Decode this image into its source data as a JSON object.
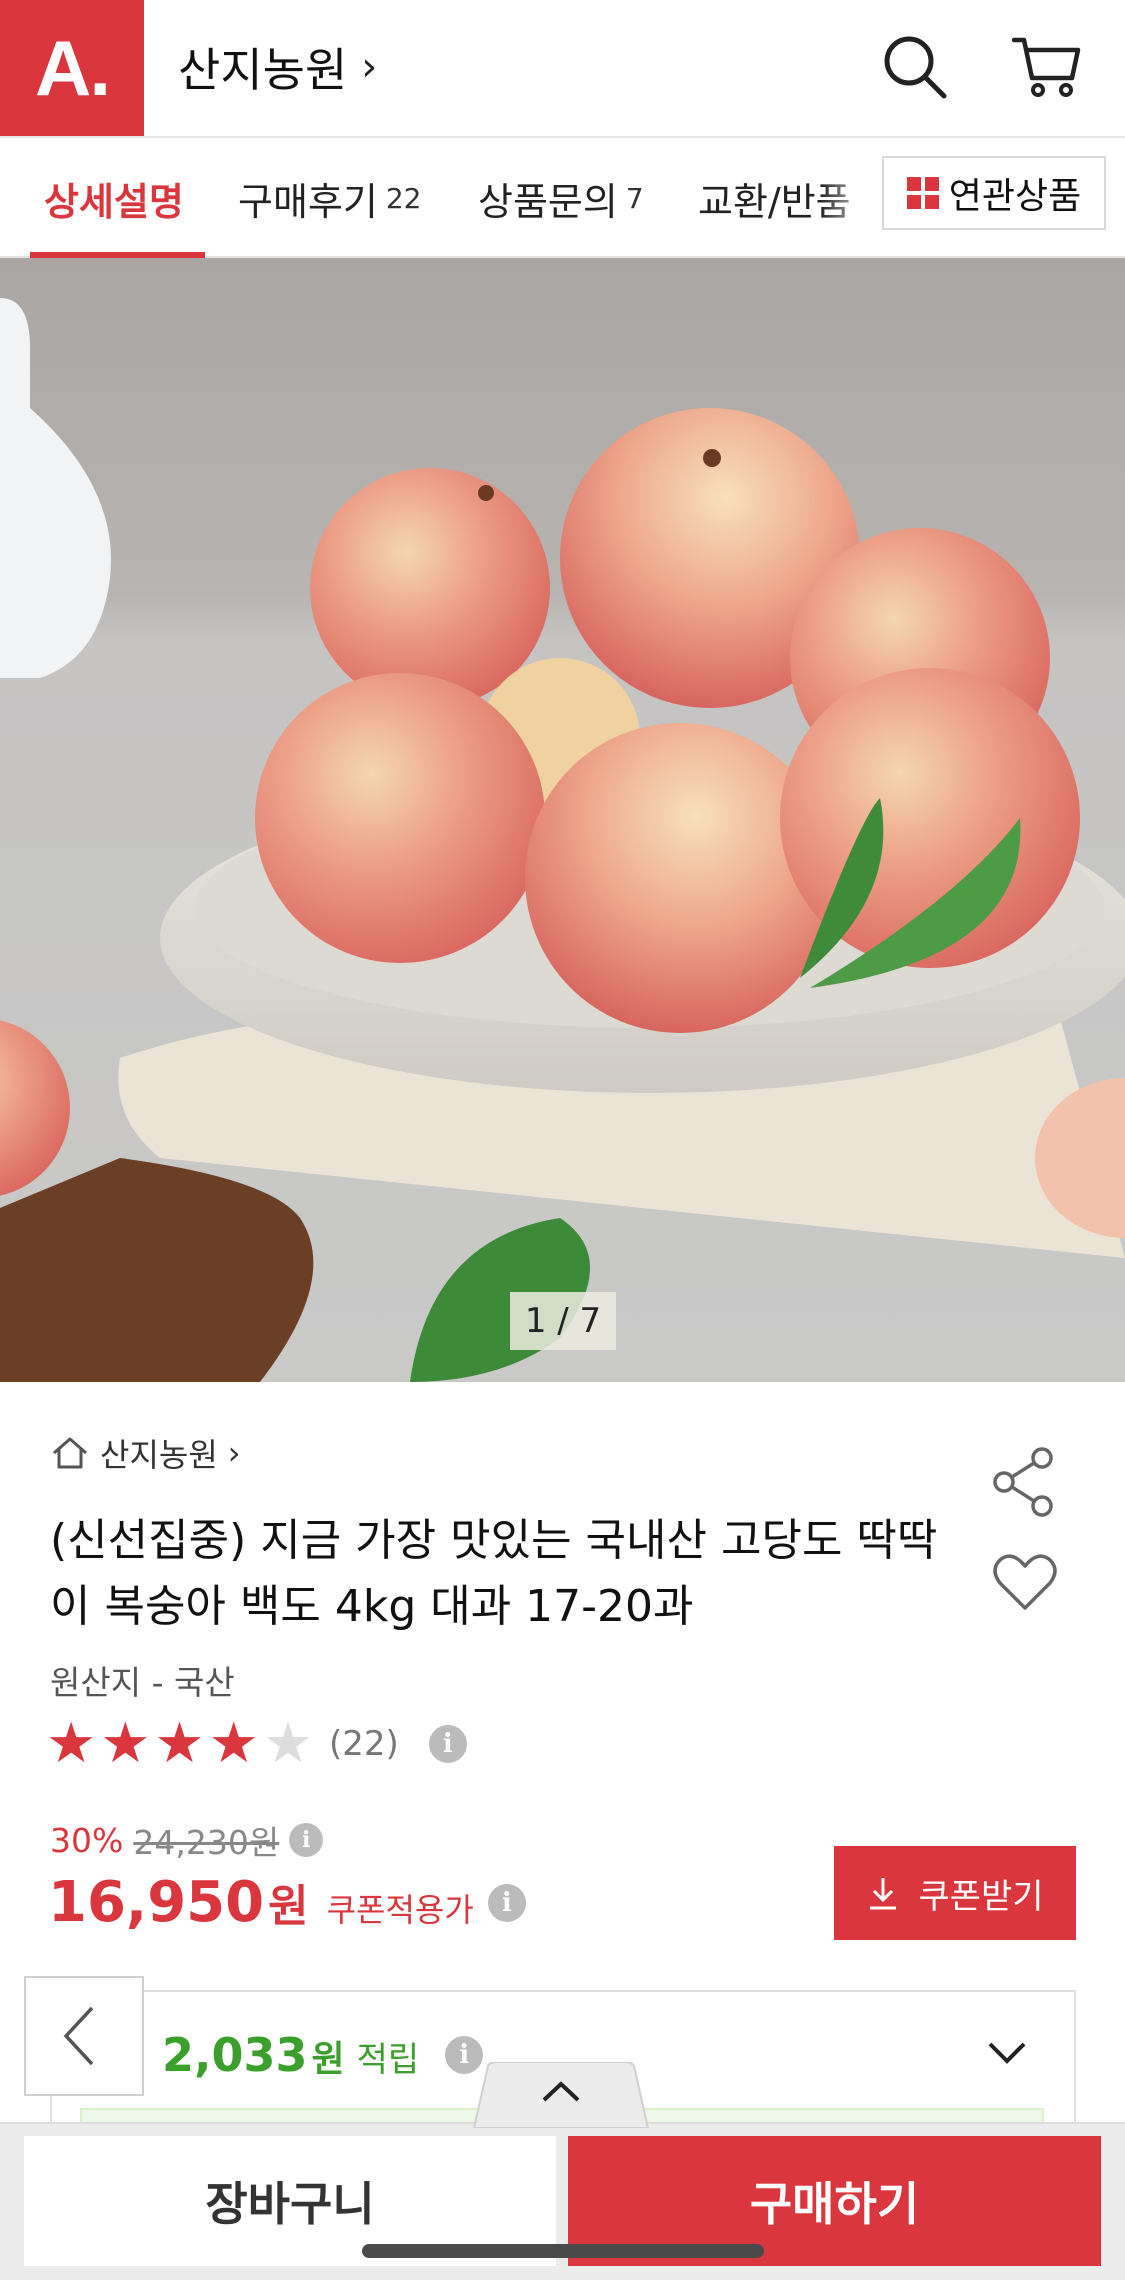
{
  "header": {
    "logo_text": "A.",
    "store_name": "산지농원",
    "chevron": "›"
  },
  "tabs": [
    {
      "label": "상세설명",
      "count": "",
      "active": true
    },
    {
      "label": "구매후기",
      "count": "22",
      "active": false
    },
    {
      "label": "상품문의",
      "count": "7",
      "active": false
    },
    {
      "label": "교환/반품",
      "count": "",
      "active": false
    }
  ],
  "related_label": "연관상품",
  "image": {
    "counter": "1 / 7"
  },
  "product": {
    "breadcrumb": "산지농원",
    "breadcrumb_chevron": "›",
    "title": "(신선집중) 지금 가장 맛있는 국내산 고당도 딱딱이 복숭아 백도 4kg 대과 17-20과",
    "origin": "원산지 - 국산",
    "rating_stars": 4,
    "rating_max": 5,
    "review_count": "(22)"
  },
  "price": {
    "discount": "30%",
    "original": "24,230원",
    "sale": "16,950",
    "unit": "원",
    "coupon_label": "쿠폰적용가",
    "coupon_button": "쿠폰받기"
  },
  "points": {
    "amount": "2,033",
    "unit": "원",
    "label": "적립"
  },
  "bottom": {
    "cart_label": "장바구니",
    "buy_label": "구매하기"
  },
  "info_glyph": "i",
  "colors": {
    "brand": "#d9363e",
    "points_green": "#3ba02b"
  }
}
